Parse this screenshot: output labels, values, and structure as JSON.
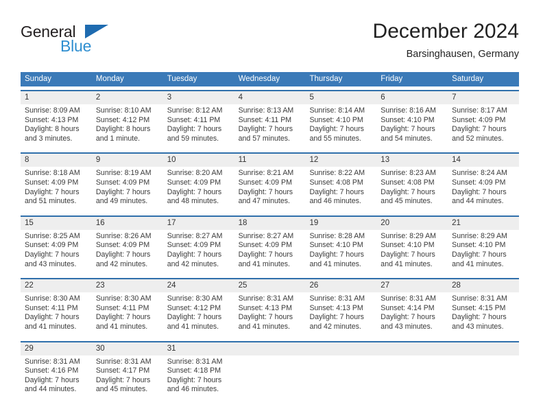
{
  "logo": {
    "text_top": "General",
    "text_bottom": "Blue",
    "triangle_color": "#1e6bb0",
    "bottom_color": "#2e8ed0"
  },
  "header": {
    "title": "December 2024",
    "subtitle": "Barsinghausen, Germany"
  },
  "theme": {
    "header_bar": "#3b7ab8",
    "row_divider": "#2f6fab",
    "daynum_band": "#eeeeee",
    "text": "#3a3a3a"
  },
  "weekdays": [
    "Sunday",
    "Monday",
    "Tuesday",
    "Wednesday",
    "Thursday",
    "Friday",
    "Saturday"
  ],
  "weeks": [
    {
      "days": [
        {
          "num": "1",
          "info": "Sunrise: 8:09 AM\nSunset: 4:13 PM\nDaylight: 8 hours\nand 3 minutes."
        },
        {
          "num": "2",
          "info": "Sunrise: 8:10 AM\nSunset: 4:12 PM\nDaylight: 8 hours\nand 1 minute."
        },
        {
          "num": "3",
          "info": "Sunrise: 8:12 AM\nSunset: 4:11 PM\nDaylight: 7 hours\nand 59 minutes."
        },
        {
          "num": "4",
          "info": "Sunrise: 8:13 AM\nSunset: 4:11 PM\nDaylight: 7 hours\nand 57 minutes."
        },
        {
          "num": "5",
          "info": "Sunrise: 8:14 AM\nSunset: 4:10 PM\nDaylight: 7 hours\nand 55 minutes."
        },
        {
          "num": "6",
          "info": "Sunrise: 8:16 AM\nSunset: 4:10 PM\nDaylight: 7 hours\nand 54 minutes."
        },
        {
          "num": "7",
          "info": "Sunrise: 8:17 AM\nSunset: 4:09 PM\nDaylight: 7 hours\nand 52 minutes."
        }
      ]
    },
    {
      "days": [
        {
          "num": "8",
          "info": "Sunrise: 8:18 AM\nSunset: 4:09 PM\nDaylight: 7 hours\nand 51 minutes."
        },
        {
          "num": "9",
          "info": "Sunrise: 8:19 AM\nSunset: 4:09 PM\nDaylight: 7 hours\nand 49 minutes."
        },
        {
          "num": "10",
          "info": "Sunrise: 8:20 AM\nSunset: 4:09 PM\nDaylight: 7 hours\nand 48 minutes."
        },
        {
          "num": "11",
          "info": "Sunrise: 8:21 AM\nSunset: 4:09 PM\nDaylight: 7 hours\nand 47 minutes."
        },
        {
          "num": "12",
          "info": "Sunrise: 8:22 AM\nSunset: 4:08 PM\nDaylight: 7 hours\nand 46 minutes."
        },
        {
          "num": "13",
          "info": "Sunrise: 8:23 AM\nSunset: 4:08 PM\nDaylight: 7 hours\nand 45 minutes."
        },
        {
          "num": "14",
          "info": "Sunrise: 8:24 AM\nSunset: 4:09 PM\nDaylight: 7 hours\nand 44 minutes."
        }
      ]
    },
    {
      "days": [
        {
          "num": "15",
          "info": "Sunrise: 8:25 AM\nSunset: 4:09 PM\nDaylight: 7 hours\nand 43 minutes."
        },
        {
          "num": "16",
          "info": "Sunrise: 8:26 AM\nSunset: 4:09 PM\nDaylight: 7 hours\nand 42 minutes."
        },
        {
          "num": "17",
          "info": "Sunrise: 8:27 AM\nSunset: 4:09 PM\nDaylight: 7 hours\nand 42 minutes."
        },
        {
          "num": "18",
          "info": "Sunrise: 8:27 AM\nSunset: 4:09 PM\nDaylight: 7 hours\nand 41 minutes."
        },
        {
          "num": "19",
          "info": "Sunrise: 8:28 AM\nSunset: 4:10 PM\nDaylight: 7 hours\nand 41 minutes."
        },
        {
          "num": "20",
          "info": "Sunrise: 8:29 AM\nSunset: 4:10 PM\nDaylight: 7 hours\nand 41 minutes."
        },
        {
          "num": "21",
          "info": "Sunrise: 8:29 AM\nSunset: 4:10 PM\nDaylight: 7 hours\nand 41 minutes."
        }
      ]
    },
    {
      "days": [
        {
          "num": "22",
          "info": "Sunrise: 8:30 AM\nSunset: 4:11 PM\nDaylight: 7 hours\nand 41 minutes."
        },
        {
          "num": "23",
          "info": "Sunrise: 8:30 AM\nSunset: 4:11 PM\nDaylight: 7 hours\nand 41 minutes."
        },
        {
          "num": "24",
          "info": "Sunrise: 8:30 AM\nSunset: 4:12 PM\nDaylight: 7 hours\nand 41 minutes."
        },
        {
          "num": "25",
          "info": "Sunrise: 8:31 AM\nSunset: 4:13 PM\nDaylight: 7 hours\nand 41 minutes."
        },
        {
          "num": "26",
          "info": "Sunrise: 8:31 AM\nSunset: 4:13 PM\nDaylight: 7 hours\nand 42 minutes."
        },
        {
          "num": "27",
          "info": "Sunrise: 8:31 AM\nSunset: 4:14 PM\nDaylight: 7 hours\nand 43 minutes."
        },
        {
          "num": "28",
          "info": "Sunrise: 8:31 AM\nSunset: 4:15 PM\nDaylight: 7 hours\nand 43 minutes."
        }
      ]
    },
    {
      "days": [
        {
          "num": "29",
          "info": "Sunrise: 8:31 AM\nSunset: 4:16 PM\nDaylight: 7 hours\nand 44 minutes."
        },
        {
          "num": "30",
          "info": "Sunrise: 8:31 AM\nSunset: 4:17 PM\nDaylight: 7 hours\nand 45 minutes."
        },
        {
          "num": "31",
          "info": "Sunrise: 8:31 AM\nSunset: 4:18 PM\nDaylight: 7 hours\nand 46 minutes."
        },
        {
          "num": "",
          "info": ""
        },
        {
          "num": "",
          "info": ""
        },
        {
          "num": "",
          "info": ""
        },
        {
          "num": "",
          "info": ""
        }
      ]
    }
  ]
}
